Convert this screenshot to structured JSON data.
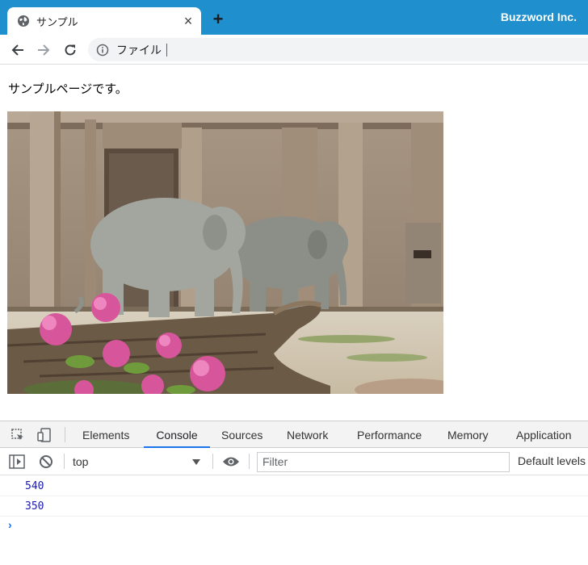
{
  "browser": {
    "tab_title": "サンプル",
    "tab_close": "×",
    "new_tab": "+",
    "brand": "Buzzword Inc.",
    "address": "ファイル",
    "colors": {
      "titlebar": "#1f8fce",
      "active_tab_underline": "#1a73e8"
    }
  },
  "page": {
    "text": "サンプルページです。",
    "image_subject": "two elephants walking past a building with pink flowers and a log in the foreground"
  },
  "devtools": {
    "tabs": [
      "Elements",
      "Console",
      "Sources",
      "Network",
      "Performance",
      "Memory",
      "Application"
    ],
    "active_tab": "Console",
    "context": "top",
    "filter_placeholder": "Filter",
    "levels": "Default levels",
    "console_output": [
      "540",
      "350"
    ],
    "prompt": "›"
  }
}
